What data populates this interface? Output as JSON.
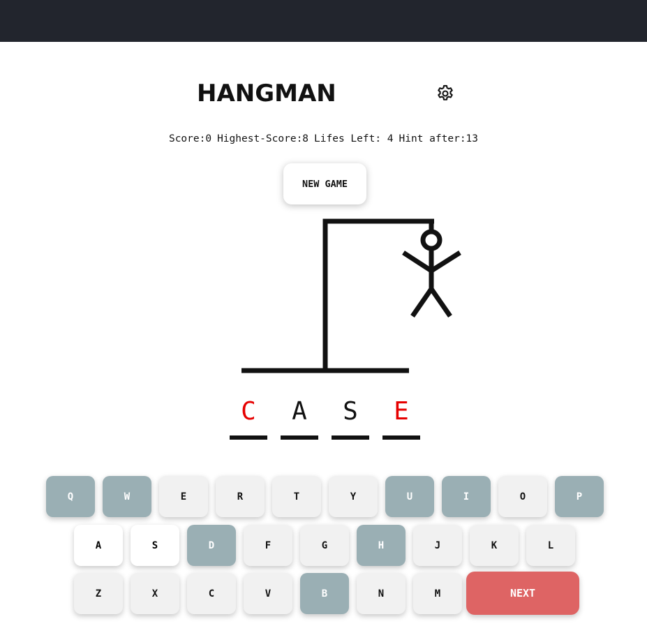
{
  "header": {
    "title": "HANGMAN",
    "settings_icon": "gear-icon"
  },
  "stats": {
    "score": "Score:0",
    "highest": "Highest-Score:8",
    "lifes": "Lifes Left: 4",
    "hint": "Hint after:13"
  },
  "new_game_label": "NEW GAME",
  "word": [
    {
      "char": "C",
      "color": "#e60000"
    },
    {
      "char": "A",
      "color": "#111111"
    },
    {
      "char": "S",
      "color": "#111111"
    },
    {
      "char": "E",
      "color": "#e60000"
    }
  ],
  "colors": {
    "key_default": "#f1f1f1",
    "key_wrong": "#9aafb4",
    "key_correct": "#52fe67",
    "next": "#de6464",
    "revealed_letter": "#e60000"
  },
  "keyboard": {
    "row1": [
      {
        "label": "Q",
        "state": "wrong"
      },
      {
        "label": "W",
        "state": "wrong"
      },
      {
        "label": "E",
        "state": "default"
      },
      {
        "label": "R",
        "state": "default"
      },
      {
        "label": "T",
        "state": "default"
      },
      {
        "label": "Y",
        "state": "default"
      },
      {
        "label": "U",
        "state": "wrong"
      },
      {
        "label": "I",
        "state": "wrong"
      },
      {
        "label": "O",
        "state": "default"
      },
      {
        "label": "P",
        "state": "wrong"
      }
    ],
    "row2": [
      {
        "label": "A",
        "state": "correct"
      },
      {
        "label": "S",
        "state": "correct"
      },
      {
        "label": "D",
        "state": "wrong"
      },
      {
        "label": "F",
        "state": "default"
      },
      {
        "label": "G",
        "state": "default"
      },
      {
        "label": "H",
        "state": "wrong"
      },
      {
        "label": "J",
        "state": "default"
      },
      {
        "label": "K",
        "state": "default"
      },
      {
        "label": "L",
        "state": "default"
      }
    ],
    "row3": [
      {
        "label": "Z",
        "state": "default"
      },
      {
        "label": "X",
        "state": "default"
      },
      {
        "label": "C",
        "state": "default"
      },
      {
        "label": "V",
        "state": "default"
      },
      {
        "label": "B",
        "state": "wrong"
      },
      {
        "label": "N",
        "state": "default"
      },
      {
        "label": "M",
        "state": "default"
      }
    ],
    "next_label": "NEXT"
  }
}
